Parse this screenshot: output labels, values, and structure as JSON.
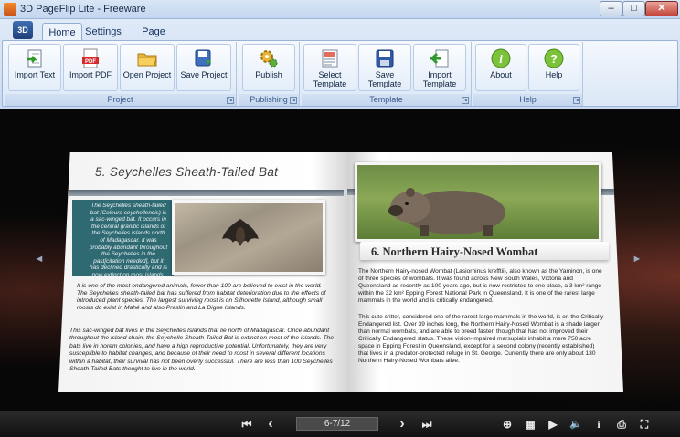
{
  "window": {
    "title": "3D PageFlip Lite - Freeware",
    "minimize": "–",
    "maximize": "□",
    "close": "✕"
  },
  "ribbon": {
    "app_button": "3D",
    "tabs": [
      "Home",
      "Settings",
      "Page Layout"
    ],
    "active_tab": "Home",
    "groups": {
      "project": {
        "label": "Project",
        "buttons": [
          "Import Text",
          "Import PDF",
          "Open Project",
          "Save Project"
        ]
      },
      "publishing": {
        "label": "Publishing",
        "buttons": [
          "Publish"
        ]
      },
      "template": {
        "label": "Template",
        "buttons": [
          "Select Template",
          "Save Template",
          "Import Template"
        ]
      },
      "help": {
        "label": "Help",
        "buttons": [
          "About",
          "Help"
        ]
      }
    },
    "icons": {
      "import_text": "import-text-icon",
      "import_pdf": "pdf-icon",
      "open_project": "folder-icon",
      "save_project": "save-project-icon",
      "publish": "publish-gear-icon",
      "select_template": "template-icon",
      "save_template": "floppy-disk-icon",
      "import_template": "import-arrow-icon",
      "about": "info-icon",
      "help": "question-icon"
    }
  },
  "book": {
    "left_page": {
      "title": "5. Seychelles Sheath-Tailed Bat",
      "box_text": "The Seychelles sheath-tailed bat (Coleura seychellensis) is a sac-winged bat. It occurs in the central granitic islands of the Seychelles Islands north of Madagascar. It was probably abundant throughout the Seychelles in the past[citation needed], but it has declined drastically and is now extinct on most islands.",
      "paragraph1": "It is one of the most endangered animals, fewer than 100 are believed to exist in the world. The Seychelles sheath-tailed bat has suffered from habitat deterioration due to the effects of introduced plant species. The largest surviving roost is on Silhouette Island, although small roosts do exist in Mahé and also Praslin and La Digue Islands.",
      "paragraph2": "This sac-winged bat lives in the Seychelles Islands that lie north of Madagascar. Once abundant throughout the island chain, the Seychelle Sheath-Tailed Bat is extinct on most of the islands. The bats live in horem colonies, and have a high reproductive potential. Unfortunately, they are very susceptible to habitat changes, and because of their need to roost in several different locations within a habitat, their survival has not been overly successful. There are less than 100 Seychelles Sheath-Tailed Bats thought to live in the world."
    },
    "right_page": {
      "title": "6. Northern Hairy-Nosed Wombat",
      "paragraph1": "The Northern Hairy-nosed Wombat (Lasiorhinus krefftii), also known as the Yaminon, is one of three species of wombats. It was found across New South Wales, Victoria and Queensland as recently as 100 years ago, but is now restricted to one place, a 3 km² range within the 32 km² Epping Forest National Park in Queensland. It is one of the rarest large mammals in the world and is critically endangered.",
      "paragraph2": "This cute critter, considered one of the rarest large mammals in the world, is on the Critically Endangered list. Over 39 inches long, the Northern Hairy-Nosed Wombat is a shade larger than normal wombats, and are able to breed faster, though that has not improved their Critically Endangered status. These vision-impaired marsupials inhabit a mere 750 acre space in Epping Forest in Queensland, except for a second colony (recently established) that lives in a predator-protected refuge in St. George. Currently there are only about 130 Northern Hairy-Nosed Wombats alive."
    }
  },
  "viewer": {
    "prev_arrow": "◄",
    "next_arrow": "►"
  },
  "toolbar": {
    "first_page": "⏮",
    "prev_page": "‹",
    "page_indicator": "6-7/12",
    "next_page": "›",
    "last_page": "⏭",
    "zoom": "⊕",
    "thumbnails": "▦",
    "play": "▶",
    "sound": "🔈",
    "info": "i",
    "print": "⎙",
    "fullscreen": "⛶"
  }
}
